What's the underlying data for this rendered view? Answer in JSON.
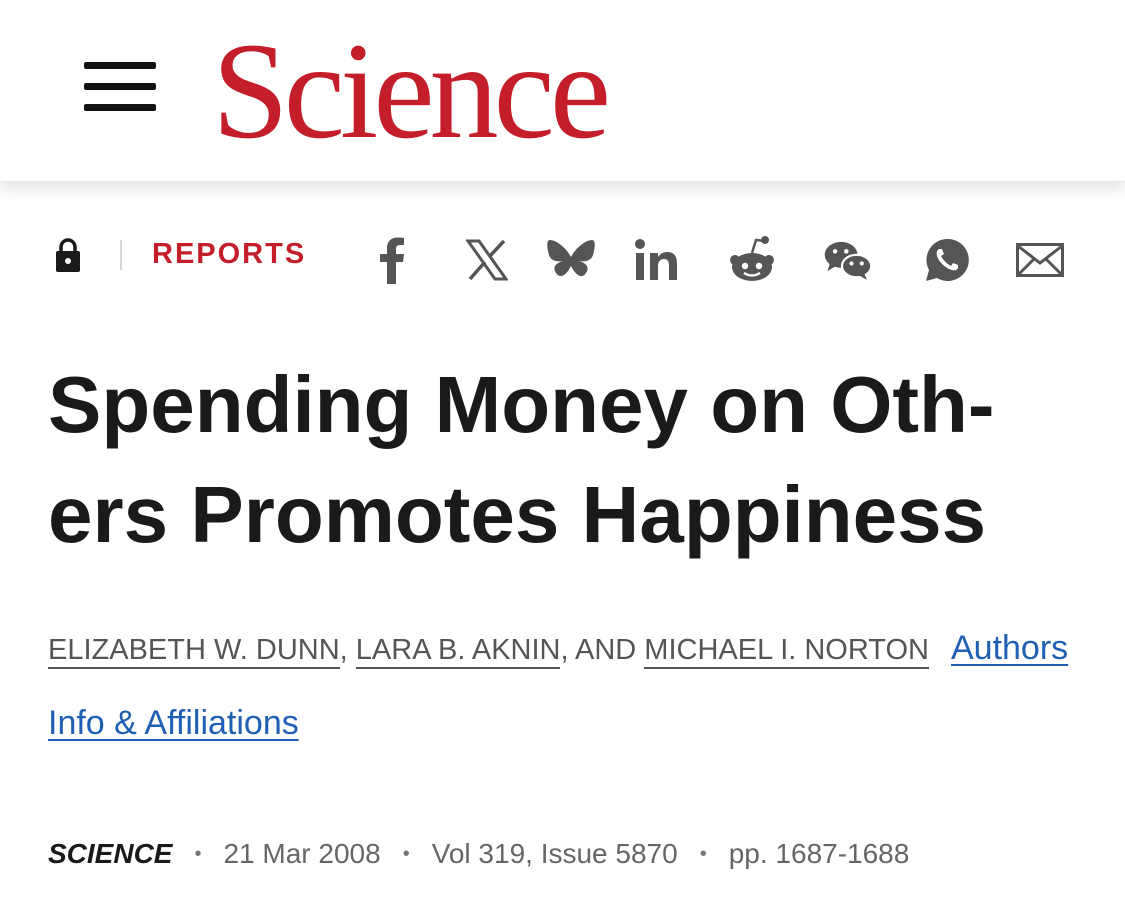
{
  "header": {
    "logo_text": "Science",
    "brand_color": "#c41e2a",
    "menu_icon": "hamburger-menu-icon"
  },
  "toolbar": {
    "access_icon": "lock-icon",
    "section_label": "REPORTS",
    "share_icons": [
      "facebook-icon",
      "x-icon",
      "bluesky-icon",
      "linkedin-icon",
      "reddit-icon",
      "wechat-icon",
      "whatsapp-icon",
      "email-icon"
    ]
  },
  "article": {
    "title": "Spending Money on Oth-ers Promotes Happiness",
    "authors": [
      "ELIZABETH W. DUNN",
      "LARA B. AKNIN",
      "MICHAEL I. NORTON"
    ],
    "author_sep_1": ", ",
    "author_sep_2": ", AND ",
    "authors_link_label": "Authors",
    "info_link_label": "Info & Affiliations",
    "link_color": "#1f5fb4"
  },
  "citation": {
    "journal": "SCIENCE",
    "date": "21 Mar 2008",
    "volume_issue": "Vol 319, Issue 5870",
    "pages": "pp. 1687-1688",
    "separator": "•"
  }
}
